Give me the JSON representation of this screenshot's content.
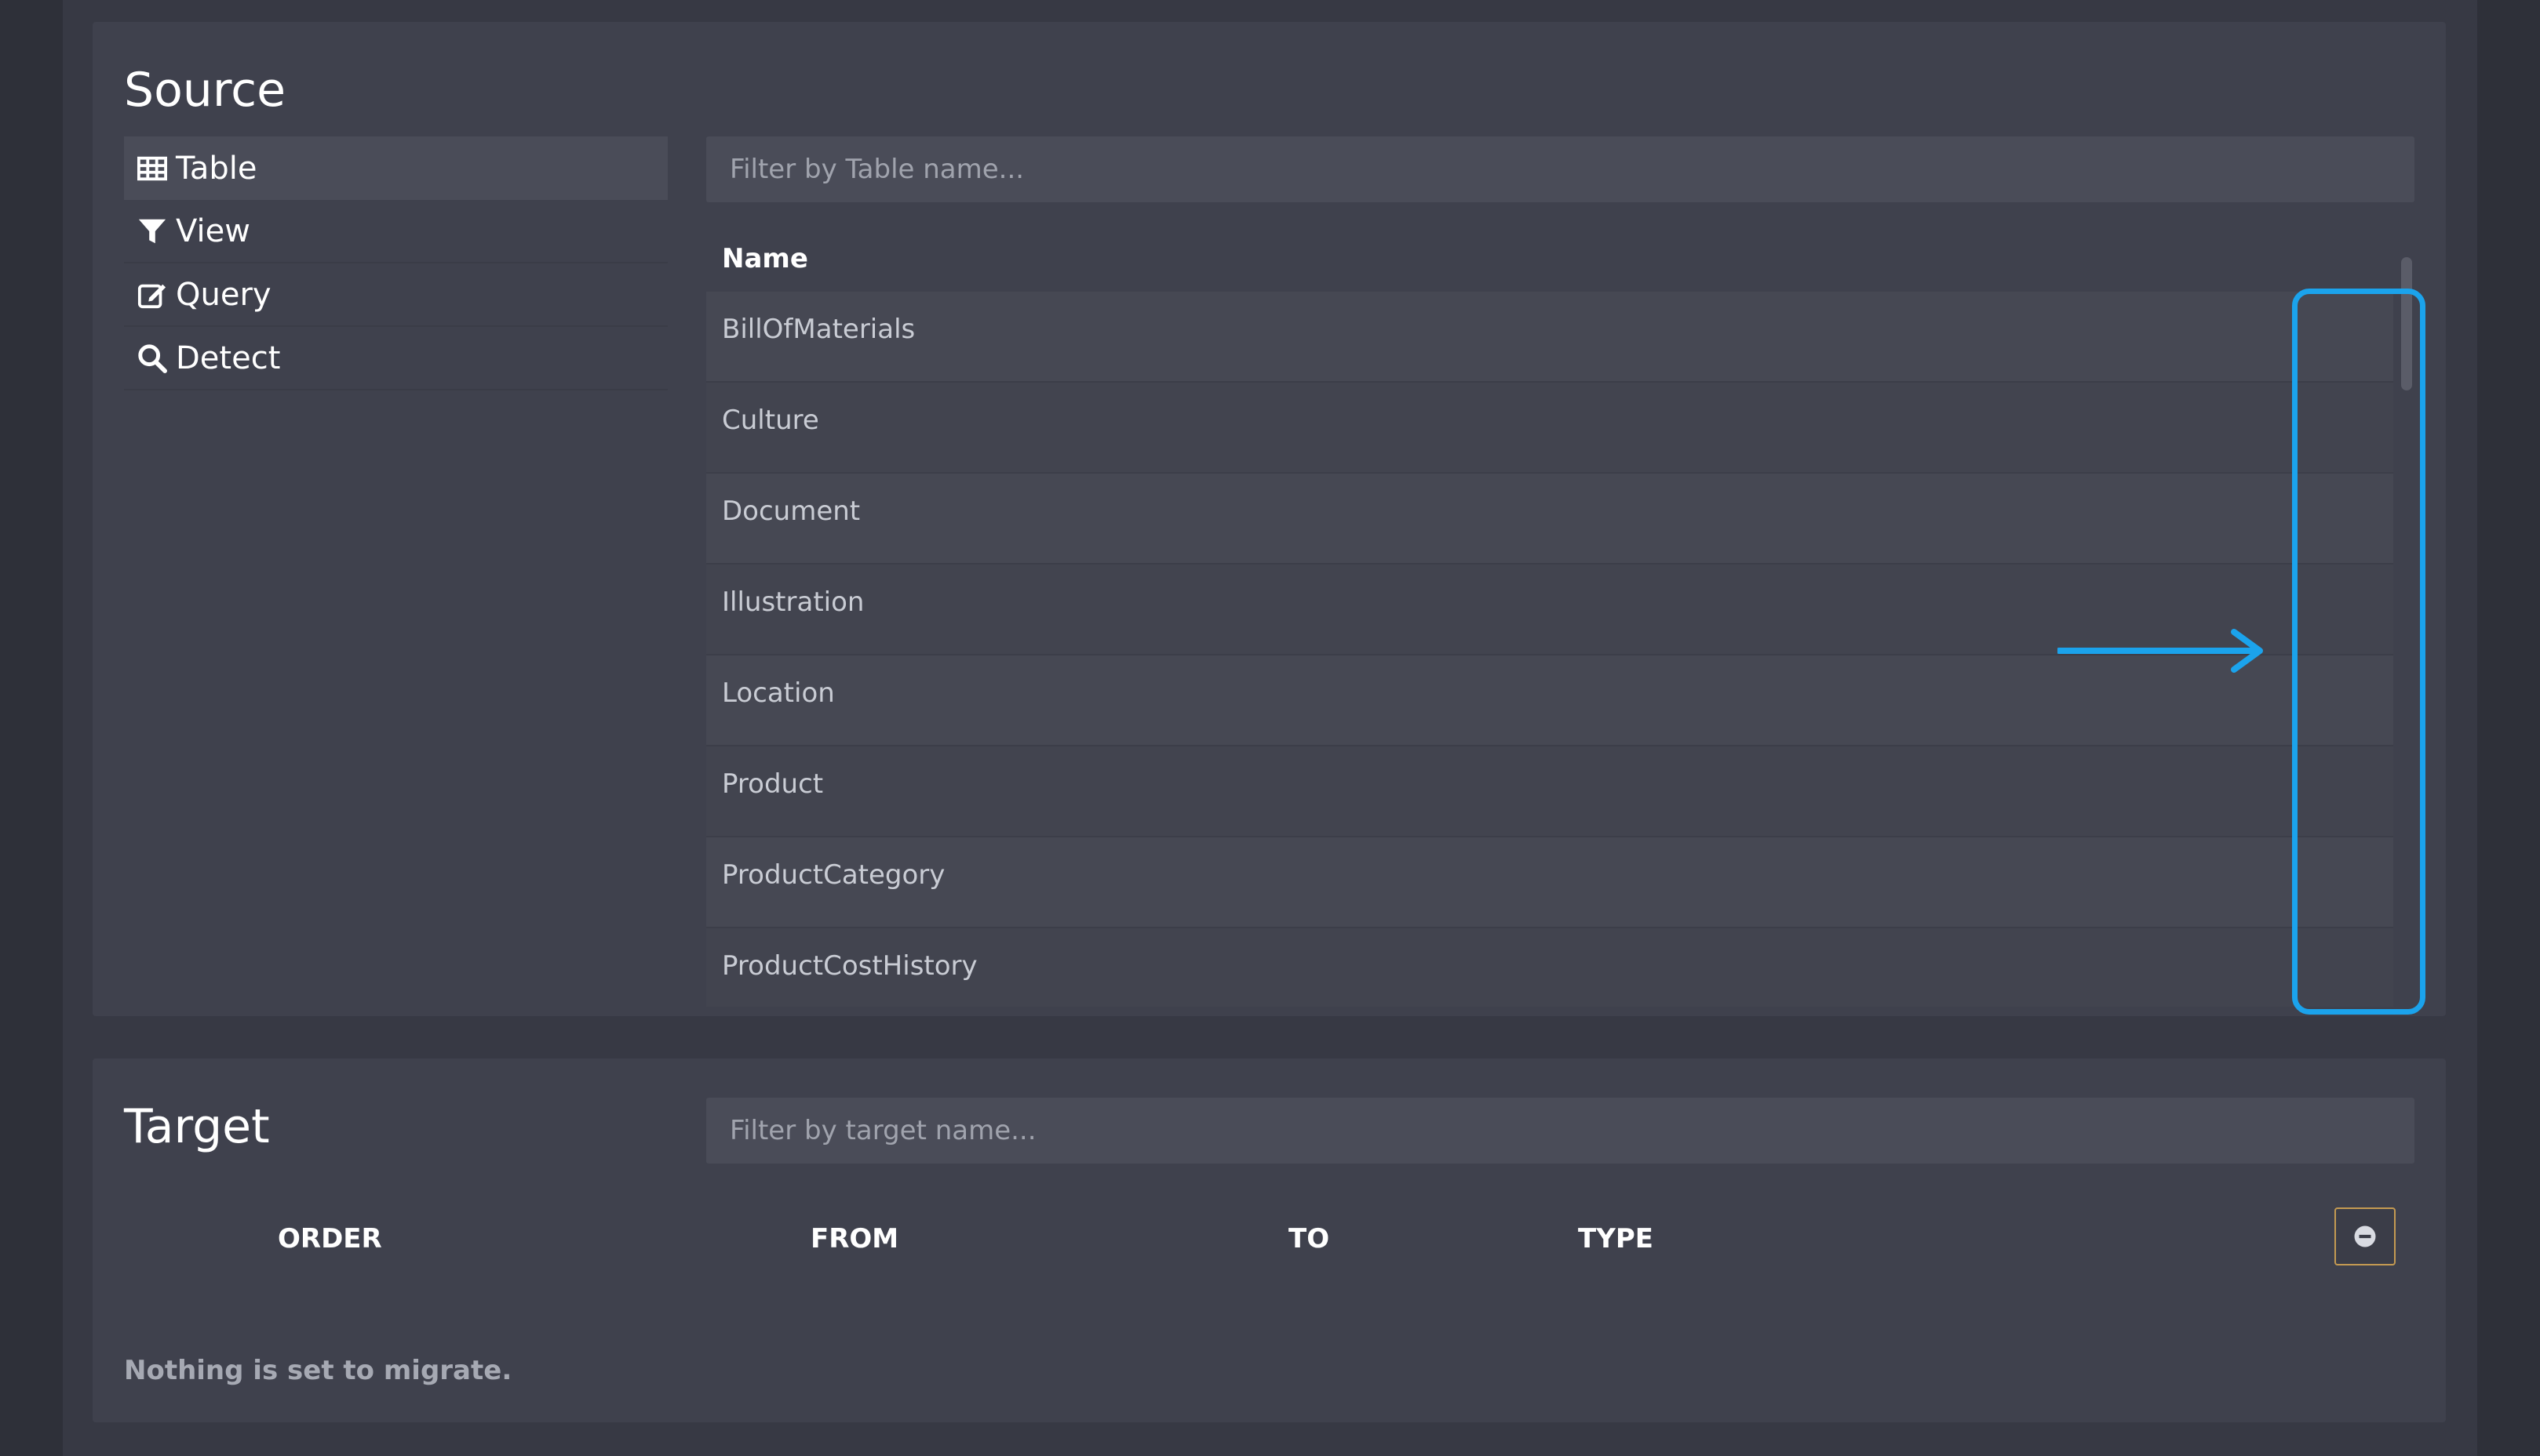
{
  "source": {
    "title": "Source",
    "nav": [
      {
        "label": "Table",
        "icon": "table-icon",
        "active": true
      },
      {
        "label": "View",
        "icon": "filter-icon",
        "active": false
      },
      {
        "label": "Query",
        "icon": "edit-icon",
        "active": false
      },
      {
        "label": "Detect",
        "icon": "search-icon",
        "active": false
      }
    ],
    "filter_placeholder": "Filter by Table name...",
    "table": {
      "header_name": "Name",
      "rows": [
        "BillOfMaterials",
        "Culture",
        "Document",
        "Illustration",
        "Location",
        "Product",
        "ProductCategory",
        "ProductCostHistory"
      ]
    }
  },
  "target": {
    "title": "Target",
    "filter_placeholder": "Filter by target name...",
    "columns": {
      "order": "ORDER",
      "from": "FROM",
      "to": "TO",
      "type": "TYPE"
    },
    "empty_message": "Nothing is set to migrate."
  },
  "colors": {
    "accent_border": "#c49a52",
    "annotation": "#1ba3ec"
  }
}
